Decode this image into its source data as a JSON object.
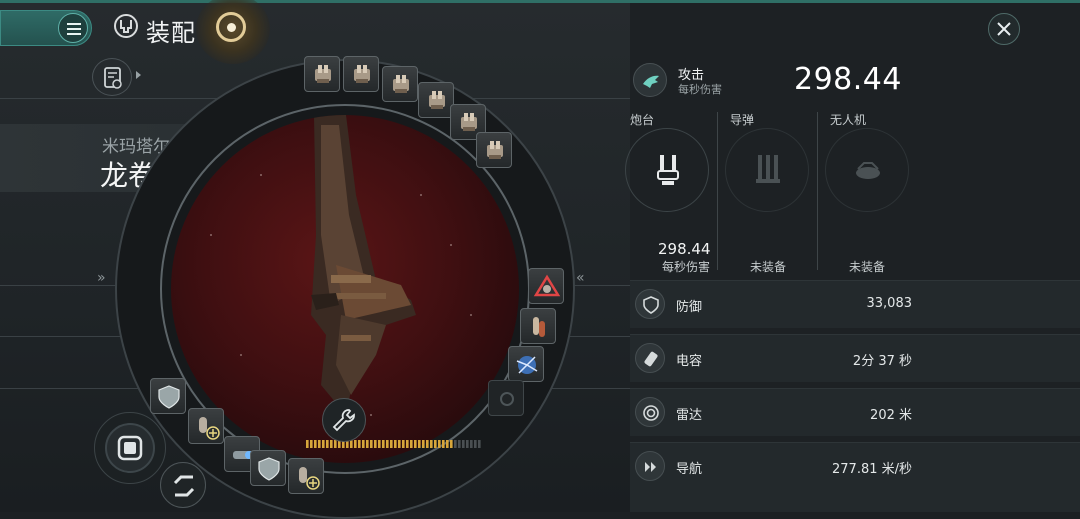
{
  "header": {
    "title": "装配",
    "menu_icon": "hamburger-icon",
    "close_icon": "close-icon"
  },
  "ship": {
    "faction": "米玛塔尔",
    "name": "龙卷风级",
    "name_arrow": "»"
  },
  "nav": {
    "left_chevron": "»",
    "right_chevron": "«"
  },
  "attack": {
    "title": "攻击",
    "subtitle": "每秒伤害",
    "value": "298.44"
  },
  "weapons": [
    {
      "label": "炮台",
      "value": "298.44",
      "sub": "每秒伤害",
      "icon": "turret-icon"
    },
    {
      "label": "导弹",
      "value": "",
      "sub": "未装备",
      "icon": "missile-icon"
    },
    {
      "label": "无人机",
      "value": "",
      "sub": "未装备",
      "icon": "drone-icon"
    }
  ],
  "stats": [
    {
      "label": "防御",
      "value": "33,083",
      "icon": "shield-icon"
    },
    {
      "label": "电容",
      "value": "2分 37 秒",
      "icon": "capacitor-icon"
    },
    {
      "label": "雷达",
      "value": "202 米",
      "icon": "radar-icon"
    },
    {
      "label": "导航",
      "value": "277.81 米/秒",
      "icon": "navigation-icon"
    }
  ],
  "energy_bar_fill": 0.82,
  "colors": {
    "accent": "#2f6f66",
    "energy": "#d7a63b",
    "viewport_red": "#4a1214"
  }
}
